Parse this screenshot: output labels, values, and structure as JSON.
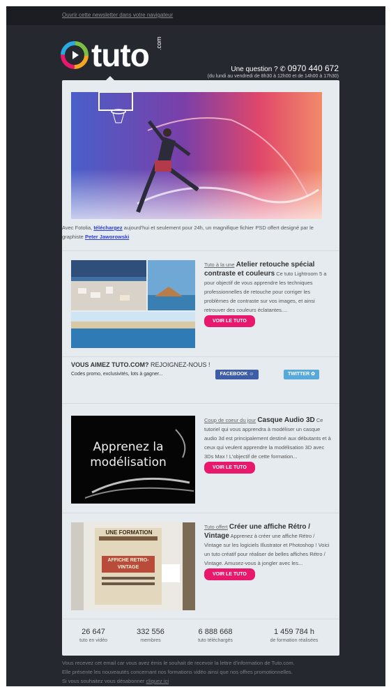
{
  "topbar": {
    "browser_link": "Ouvrir cette newsletter dans votre navigateur"
  },
  "header": {
    "logo_text": "tuto",
    "logo_suffix": ".com",
    "question": "Une question ?",
    "phone": "0970 440 672",
    "hours": "(du lundi au vendredi de 8h30 à 12h00 et de 14h00 à 17h30)"
  },
  "hero": {
    "caption_before": "Avec Fotolia, ",
    "caption_link": "téléchargez",
    "caption_after": " aujourd'hui et seulement pour 24h, un magnifique fichier PSD offert designé par le graphiste ",
    "author_link": "Peter Jaworowski"
  },
  "articles": [
    {
      "tag": "Tuto à la une",
      "title": "Atelier retouche spécial contraste et couleurs",
      "desc": "Ce tuto Lightroom 5 a pour objectif de vous apprendre les techniques professionnelles de retouche pour corriger les problèmes de contraste sur vos images, et ainsi retrouver des couleurs éclatantes....",
      "button": "VOIR LE TUTO"
    },
    {
      "tag": "Coup de coeur du jour",
      "title": "Casque Audio 3D",
      "desc": "Ce tutoriel qui vous apprendra à modéliser un casque audio 3d est principalement destiné aux débutants et à ceux qui veulent apprendre la modélisation 3D avec 3Ds Max ! L'objectif de cette formation...",
      "button": "VOIR LE TUTO",
      "image_text": "Apprenez la modélisation"
    },
    {
      "tag": "Tuto offert",
      "title": "Créer une affiche Rétro / Vintage",
      "desc": "Apprenez à créer une affiche Rétro / Vintage sur les logiciels Illustrator et Photoshop ! Voici un tuto créatif pour réaliser de belles affiches Rétro / Vintage. Amusez-vous à jongler avec les...",
      "button": "VOIR LE TUTO",
      "image_text": "UNE FORMATION",
      "image_sub": "AFFICHE RETRO-VINTAGE"
    }
  ],
  "social": {
    "headline": "VOUS AIMEZ TUTO.COM?",
    "headline_rest": " REJOIGNEZ-NOUS !",
    "sub": "Codes promo, exclusivités, lots à gagner...",
    "facebook": "FACEBOOK",
    "twitter": "TWITTER"
  },
  "stats": [
    {
      "value": "26 647",
      "label": "tuto en vidéo"
    },
    {
      "value": "332 556",
      "label": "membres"
    },
    {
      "value": "6 888 668",
      "label": "tuto téléchargés"
    },
    {
      "value": "1 459 784 h",
      "label": "de formation réalisées"
    }
  ],
  "footer": {
    "line1": "Vous recevez cet email car vous avez émis le souhait de recevoir la lettre d'information de Tuto.com.",
    "line2": "Elle présente les nouveautés concernant nos formations vidéo ainsi que nos offres promotionnelles.",
    "line3": "Si vous souhaitez vous désabonner ",
    "unsubscribe": "cliquez ici"
  }
}
